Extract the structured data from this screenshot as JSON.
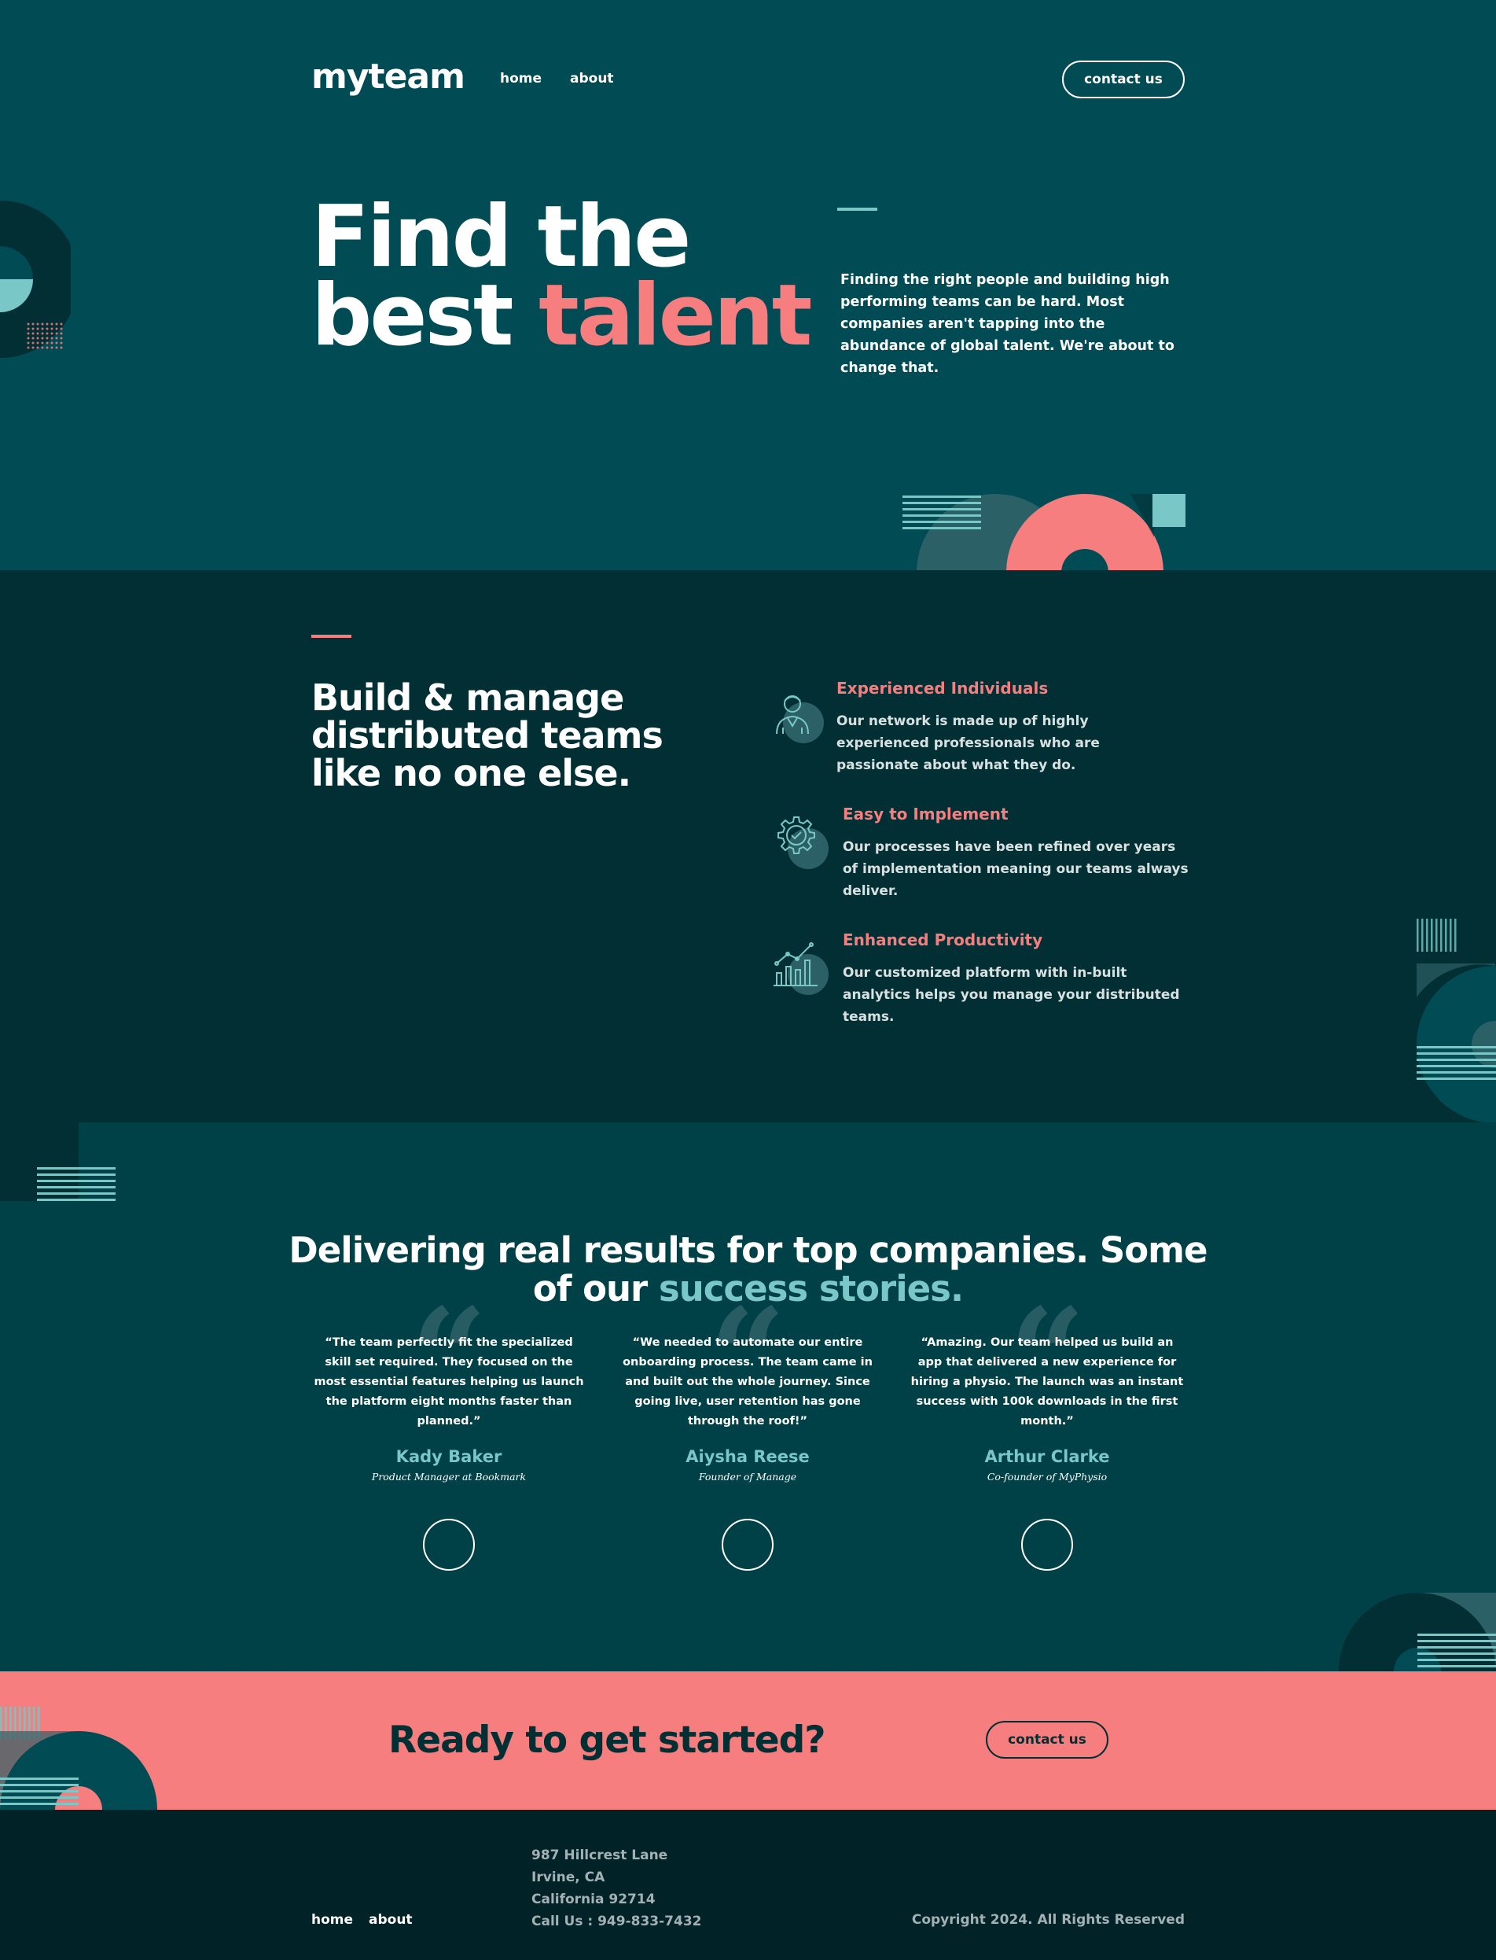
{
  "header": {
    "logo": "myteam",
    "nav": [
      "home",
      "about"
    ],
    "contact_button": "contact us"
  },
  "hero": {
    "title_line1": "Find the",
    "title_line2_plain": "best ",
    "title_line2_accent": "talent",
    "description": "Finding the right people and building high performing teams can be hard. Most companies aren't tapping into the abundance of global talent. We're about to change that."
  },
  "features": {
    "title": "Build & manage distributed teams like no one else.",
    "items": [
      {
        "icon": "person-icon",
        "title": "Experienced Individuals",
        "description": "Our network is made up of highly experienced professionals who are passionate about what they do."
      },
      {
        "icon": "cog-icon",
        "title": "Easy to Implement",
        "description": "Our processes have been refined over years of implementation meaning our teams always deliver."
      },
      {
        "icon": "chart-icon",
        "title": "Enhanced Productivity",
        "description": "Our customized platform with in-built analytics helps you manage your distributed teams."
      }
    ]
  },
  "testimonials": {
    "title_plain": "Delivering real results for top companies. Some of our ",
    "title_accent": "success stories.",
    "items": [
      {
        "quote": "“The team perfectly fit the specialized skill set required. They focused on the most essential features helping us launch the platform eight months faster than planned.”",
        "name": "Kady Baker",
        "role": "Product Manager at Bookmark"
      },
      {
        "quote": "“We needed to automate our entire onboarding process. The team came in and built out the whole journey. Since going live, user retention has gone through the roof!”",
        "name": "Aiysha Reese",
        "role": "Founder of Manage"
      },
      {
        "quote": "“Amazing. Our team helped us build an app that delivered a new experience for hiring a physio. The launch was an instant success with 100k downloads in the first month.”",
        "name": "Arthur Clarke",
        "role": "Co-founder of MyPhysio"
      }
    ]
  },
  "cta": {
    "title": "Ready to get started?",
    "button": "contact us"
  },
  "footer": {
    "nav": [
      "home",
      "about"
    ],
    "address": [
      "987 Hillcrest Lane",
      "Irvine, CA",
      "California 92714",
      "Call Us : 949-833-7432"
    ],
    "copyright": "Copyright 2024. All Rights Reserved"
  },
  "colors": {
    "hero_bg": "#004B54",
    "dark_bg": "#012F34",
    "coral": "#F67E7E",
    "mint": "#79C8C7",
    "footer_bg": "#012328"
  }
}
